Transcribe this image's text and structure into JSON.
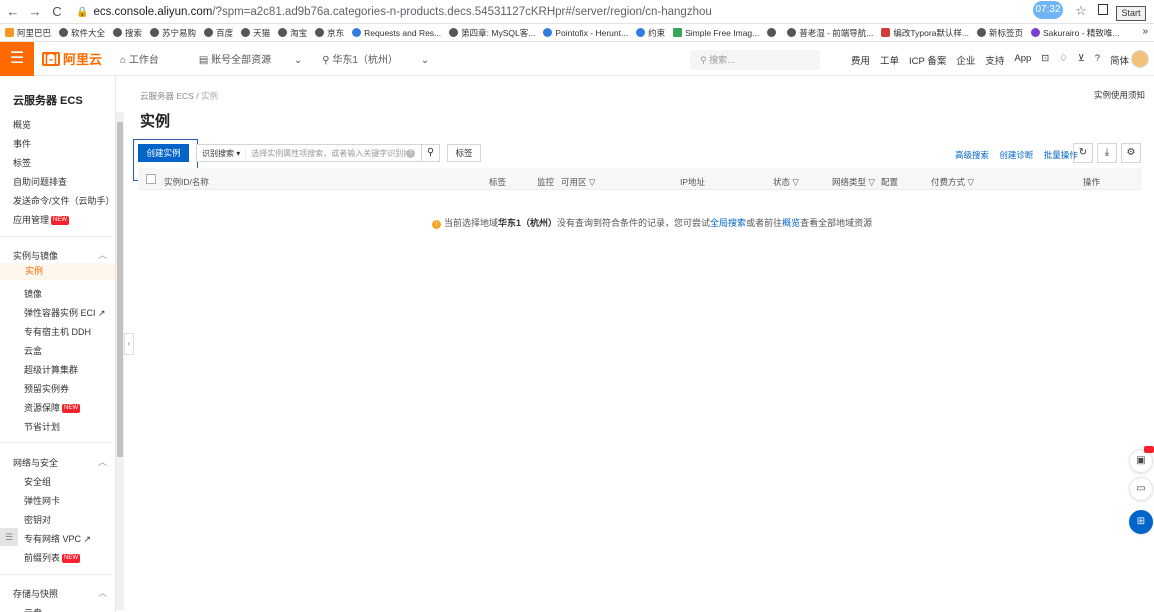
{
  "browser": {
    "url_host": "ecs.console.aliyun.com",
    "url_rest": "/?spm=a2c81.ad9b76a.categories-n-products.decs.54531127cKRHpr#/server/region/cn-hangzhou",
    "clock": "07:32",
    "start_label": "Start",
    "bookmarks": [
      {
        "label": "阿里巴巴",
        "icon": "folder-icon"
      },
      {
        "label": "软件大全",
        "icon": "globe-icon"
      },
      {
        "label": "搜索",
        "icon": "globe-icon"
      },
      {
        "label": "苏宁易购",
        "icon": "globe-icon"
      },
      {
        "label": "百度",
        "icon": "globe-icon"
      },
      {
        "label": "天猫",
        "icon": "globe-icon"
      },
      {
        "label": "淘宝",
        "icon": "globe-icon"
      },
      {
        "label": "京东",
        "icon": "globe-icon"
      },
      {
        "label": "Requests and Res...",
        "icon": "doc-icon"
      },
      {
        "label": "第四章: MySQL客...",
        "icon": "globe-icon"
      },
      {
        "label": "Pointofix - Herunt...",
        "icon": "app-icon"
      },
      {
        "label": "约束",
        "icon": "c-icon"
      },
      {
        "label": "Simple Free Imag...",
        "icon": "bars-icon"
      },
      {
        "label": "",
        "icon": "globe-icon"
      },
      {
        "label": "普老湿 - 前端导航...",
        "icon": "globe-icon"
      },
      {
        "label": "编改Typora默认样...",
        "icon": "red-icon"
      },
      {
        "label": "新标签页",
        "icon": "globe-icon"
      },
      {
        "label": "Sakurairo - 精致唯...",
        "icon": "n-icon"
      }
    ],
    "more": "»"
  },
  "topbar": {
    "logo": "阿里云",
    "workbench": "工作台",
    "account_resources": "账号全部资源",
    "region": "华东1（杭州）",
    "search_placeholder": "搜索...",
    "links": [
      "费用",
      "工单",
      "ICP 备案",
      "企业",
      "支持",
      "App"
    ],
    "lang": "简体"
  },
  "sidebar": {
    "title": "云服务器 ECS",
    "top_items": [
      "概览",
      "事件",
      "标签",
      "自助问题排查",
      "发送命令/文件（云助手）",
      "应用管理"
    ],
    "groups": [
      {
        "label": "实例与镜像",
        "items": [
          "实例",
          "镜像",
          "弹性容器实例 ECI",
          "专有宿主机 DDH",
          "云盒",
          "超级计算集群",
          "预留实例券",
          "资源保障",
          "节省计划"
        ]
      },
      {
        "label": "网络与安全",
        "items": [
          "安全组",
          "弹性网卡",
          "密钥对",
          "专有网络 VPC",
          "前缀列表"
        ]
      },
      {
        "label": "存储与快照",
        "items": [
          "云盘"
        ]
      }
    ],
    "new_tag": "NEW"
  },
  "main": {
    "breadcrumb_root": "云服务器 ECS",
    "breadcrumb_sep": "/",
    "breadcrumb_current": "实例",
    "notice_link": "实例使用须知",
    "title": "实例",
    "create_button": "创建实例",
    "search_select": "识别搜索",
    "search_placeholder": "选择实例属性项搜索，或者输入关键字识别搜索",
    "tag_button": "标签",
    "advanced_search": "高级搜索",
    "create_diagnosis": "创建诊断",
    "batch_ops": "批量操作",
    "columns": [
      "实例ID/名称",
      "标签",
      "监控",
      "可用区",
      "IP地址",
      "状态",
      "网络类型",
      "配置",
      "付费方式",
      "操作"
    ],
    "empty_prefix": "当前选择地域",
    "empty_region": "华东1（杭州）",
    "empty_middle": "没有查询到符合条件的记录，您可尝试",
    "empty_link1": "全局搜索",
    "empty_middle2": "或者前往",
    "empty_link2": "概览",
    "empty_suffix": "查看全部地域资源"
  }
}
